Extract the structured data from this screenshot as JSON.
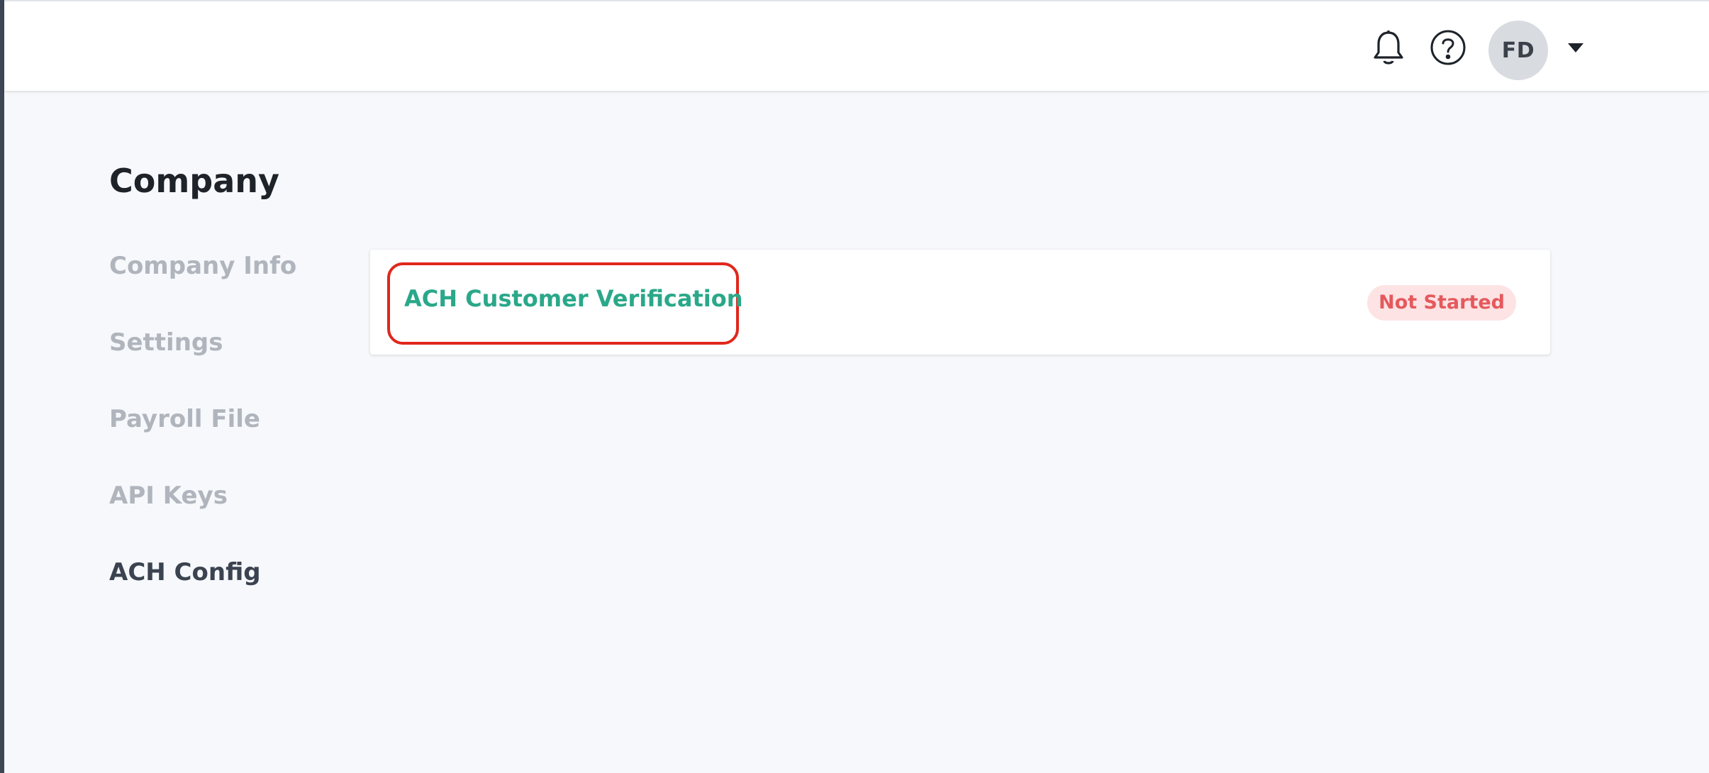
{
  "header": {
    "notifications_icon": "bell-icon",
    "help_icon": "question-circle-icon",
    "user_initials": "FD",
    "user_menu_icon": "caret-down-icon"
  },
  "page": {
    "title": "Company"
  },
  "sidebar": {
    "items": [
      {
        "label": "Company Info",
        "active": false
      },
      {
        "label": "Settings",
        "active": false
      },
      {
        "label": "Payroll File",
        "active": false
      },
      {
        "label": "API Keys",
        "active": false
      },
      {
        "label": "ACH Config",
        "active": true
      }
    ]
  },
  "main": {
    "row": {
      "label": "ACH Customer Verification",
      "status": "Not Started"
    }
  },
  "colors": {
    "accent_green": "#2aa889",
    "status_red_text": "#e5595d",
    "status_red_bg": "#fde3e4",
    "highlight_red": "#e0271c"
  }
}
